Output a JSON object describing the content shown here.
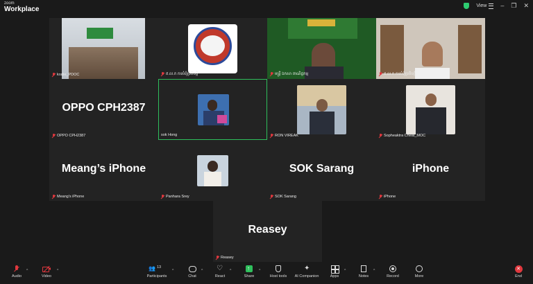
{
  "app": {
    "brand_top": "zoom",
    "brand_name": "Workplace"
  },
  "top_right": {
    "view_label": "View"
  },
  "tiles": [
    {
      "label": "kratie_PDOC",
      "big_text": ""
    },
    {
      "label": "ឥ.ល.ក ការ​បំពុំប្រតិបត្តិ",
      "big_text": ""
    },
    {
      "label": "មន្ត្រី ឯកសា​ ពាណិជ្ជកម្ម",
      "big_text": ""
    },
    {
      "label": "ឥ.ល.ក ការ​បំពុំប្រតិបត្តិ",
      "big_text": ""
    },
    {
      "label": "OPPO CPH2387",
      "big_text": "OPPO CPH2387"
    },
    {
      "label": "sok Hong",
      "big_text": ""
    },
    {
      "label": "RON VIREAK",
      "big_text": ""
    },
    {
      "label": "Sopheaktra Cheat_MOC",
      "big_text": ""
    },
    {
      "label": "Meang's iPhone",
      "big_text": "Meang’s iPhone"
    },
    {
      "label": "Panhara Srey",
      "big_text": ""
    },
    {
      "label": "SOK Sarang",
      "big_text": "SOK Sarang"
    },
    {
      "label": "iPhone",
      "big_text": "iPhone"
    },
    {
      "label": "Reasey",
      "big_text": "Reasey"
    }
  ],
  "toolbar": {
    "audio": "Audio",
    "video": "Video",
    "participants": "Participants",
    "participants_count": "13",
    "chat": "Chat",
    "react": "React",
    "share": "Share",
    "host_tools": "Host tools",
    "ai_companion": "AI Companion",
    "apps": "Apps",
    "notes": "Notes",
    "record": "Record",
    "more": "More",
    "end": "End"
  },
  "icons": {
    "mic_off": "mic-off-icon",
    "video_off": "video-off-icon",
    "shield": "shield-icon",
    "end": "end-icon"
  },
  "colors": {
    "muted_red": "#e0383e",
    "active_border": "#2fbf5c",
    "share_green": "#2fbf5c",
    "background": "#1a1a1a",
    "tile": "#232323"
  }
}
